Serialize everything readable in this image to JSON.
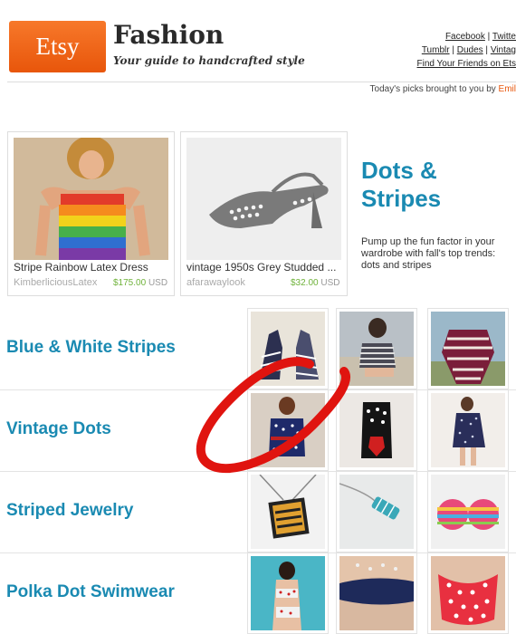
{
  "header": {
    "logo_text": "Etsy",
    "title": "Fashion",
    "subtitle": "Your guide to handcrafted style",
    "links": {
      "facebook": "Facebook",
      "twitter": "Twitte",
      "tumblr": "Tumblr",
      "dudes": "Dudes",
      "vintage": "Vintag",
      "find_friends": "Find Your Friends on Ets"
    },
    "separator": "|",
    "picks_text": "Today's picks brought to you by",
    "picks_curator": "Emil"
  },
  "feature": {
    "items": [
      {
        "title": "Stripe Rainbow Latex Dress",
        "shop": "KimberliciousLatex",
        "price": "$175.00",
        "currency": "USD"
      },
      {
        "title": "vintage 1950s Grey Studded ...",
        "shop": "afarawaylook",
        "price": "$32.00",
        "currency": "USD"
      }
    ],
    "theme_title": "Dots & Stripes",
    "theme_desc": "Pump up the fun factor in your wardrobe with fall's top trends: dots and stripes"
  },
  "rows": [
    {
      "title": "Blue & White Stripes"
    },
    {
      "title": "Vintage Dots"
    },
    {
      "title": "Striped Jewelry"
    },
    {
      "title": "Polka Dot Swimwear"
    }
  ],
  "colors": {
    "accent_blue": "#1a8ab2",
    "etsy_orange": "#e8560b",
    "price_green": "#6fb23a",
    "annotation_red": "#e0140f"
  }
}
